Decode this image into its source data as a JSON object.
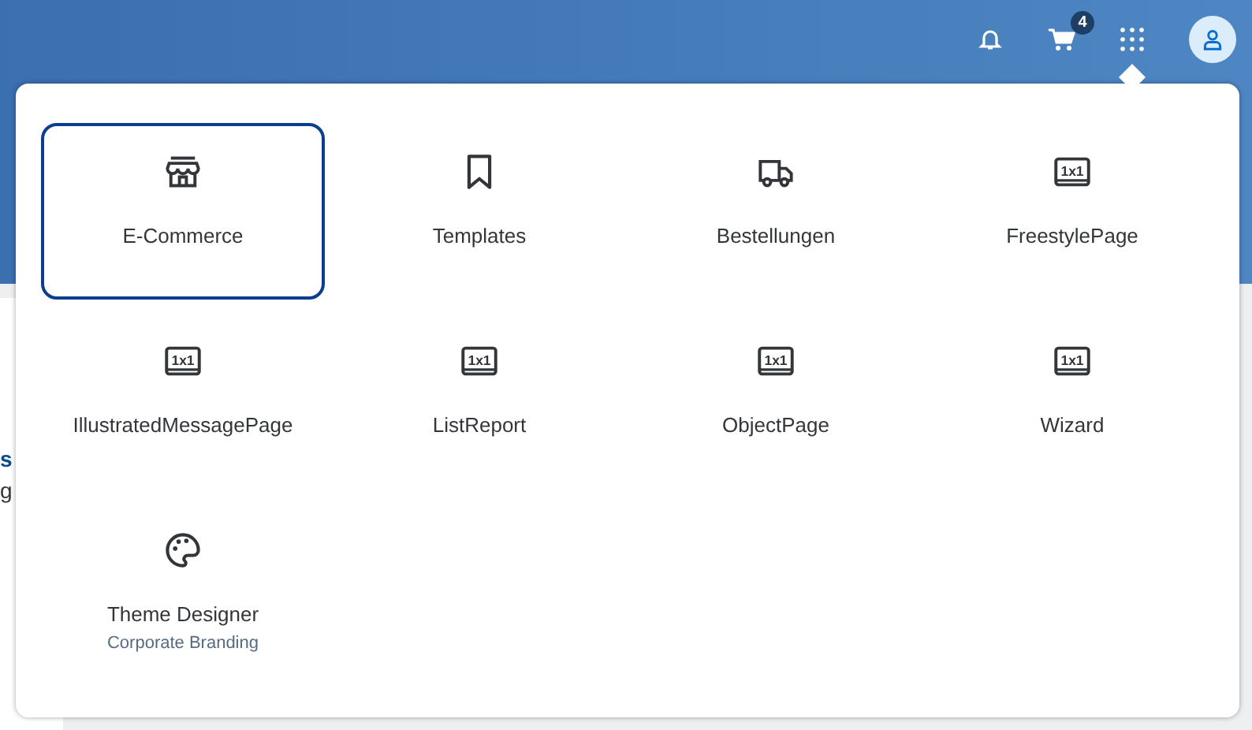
{
  "shell_bar": {
    "notifications": {
      "kind": "bell"
    },
    "cart": {
      "badge": "4"
    },
    "apps_menu": {
      "selected": true
    }
  },
  "background": {
    "fragments": [
      {
        "text": "s",
        "kind": "link"
      },
      {
        "text": "g",
        "kind": "plain"
      }
    ]
  },
  "apps": [
    {
      "label": "E-Commerce",
      "kind": "store",
      "selected": true
    },
    {
      "label": "Templates",
      "kind": "bookmark",
      "selected": false
    },
    {
      "label": "Bestellungen",
      "kind": "truck",
      "selected": false
    },
    {
      "label": "FreestylePage",
      "kind": "tile",
      "icon_label": "1x1",
      "selected": false
    },
    {
      "label": "IllustratedMessagePage",
      "kind": "tile",
      "icon_label": "1x1",
      "selected": false
    },
    {
      "label": "ListReport",
      "kind": "tile",
      "icon_label": "1x1",
      "selected": false
    },
    {
      "label": "ObjectPage",
      "kind": "tile",
      "icon_label": "1x1",
      "selected": false
    },
    {
      "label": "Wizard",
      "kind": "tile",
      "icon_label": "1x1",
      "selected": false
    },
    {
      "label": "Theme Designer",
      "subtitle": "Corporate Branding",
      "kind": "palette",
      "selected": false
    }
  ]
}
